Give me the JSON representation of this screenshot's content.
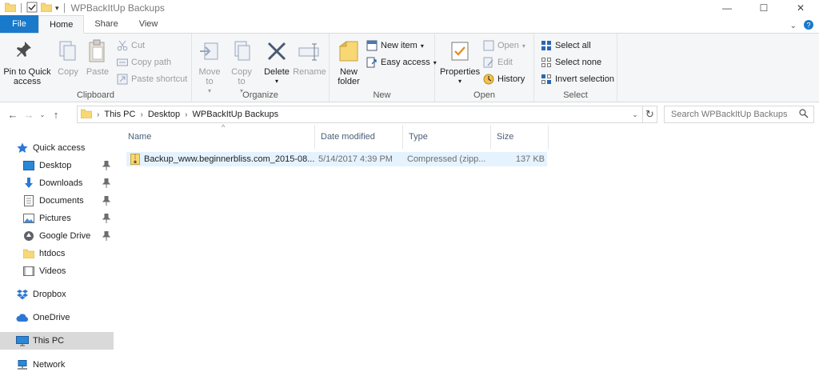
{
  "window": {
    "title": "WPBackItUp Backups",
    "controls": [
      "—",
      "☐",
      "✕"
    ]
  },
  "tabs": [
    {
      "label": "File"
    },
    {
      "label": "Home"
    },
    {
      "label": "Share"
    },
    {
      "label": "View"
    }
  ],
  "ribbon": {
    "clipboard": {
      "label": "Clipboard",
      "pin": "Pin to Quick access",
      "copy": "Copy",
      "paste": "Paste",
      "cut": "Cut",
      "copy_path": "Copy path",
      "paste_shortcut": "Paste shortcut"
    },
    "organize": {
      "label": "Organize",
      "move_to": "Move to",
      "copy_to": "Copy to",
      "delete": "Delete",
      "rename": "Rename"
    },
    "new": {
      "label": "New",
      "new_folder": "New folder",
      "new_item": "New item",
      "easy_access": "Easy access"
    },
    "open": {
      "label": "Open",
      "properties": "Properties",
      "open": "Open",
      "edit": "Edit",
      "history": "History"
    },
    "select": {
      "label": "Select",
      "select_all": "Select all",
      "select_none": "Select none",
      "invert_selection": "Invert selection"
    }
  },
  "address": {
    "breadcrumbs": [
      "This PC",
      "Desktop",
      "WPBackItUp Backups"
    ],
    "search_placeholder": "Search WPBackItUp Backups"
  },
  "sidebar": {
    "items": [
      {
        "label": "Quick access"
      },
      {
        "label": "Desktop"
      },
      {
        "label": "Downloads"
      },
      {
        "label": "Documents"
      },
      {
        "label": "Pictures"
      },
      {
        "label": "Google Drive"
      },
      {
        "label": "htdocs"
      },
      {
        "label": "Videos"
      },
      {
        "label": "Dropbox"
      },
      {
        "label": "OneDrive"
      },
      {
        "label": "This PC"
      },
      {
        "label": "Network"
      }
    ]
  },
  "columns": [
    "Name",
    "Date modified",
    "Type",
    "Size"
  ],
  "files": [
    {
      "name": "Backup_www.beginnerbliss.com_2015-08...",
      "date": "5/14/2017 4:39 PM",
      "type": "Compressed (zipp...",
      "size": "137 KB"
    }
  ],
  "colors": {
    "file_tab": "#1979ca",
    "selection": "#e5f3ff",
    "folder": "#f8d775"
  }
}
